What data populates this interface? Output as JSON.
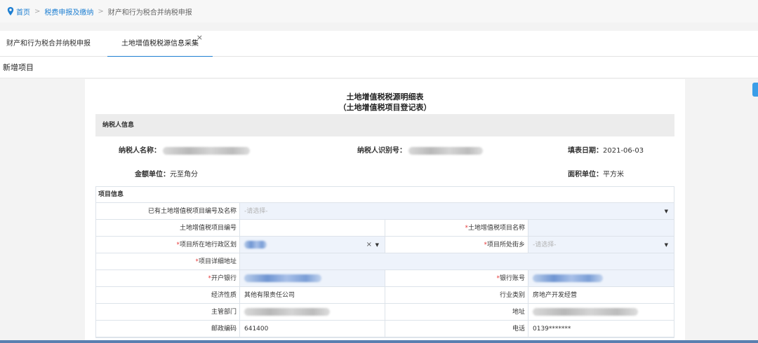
{
  "breadcrumb": {
    "home": "首页",
    "sep": ">",
    "level2": "税费申报及缴纳",
    "current": "财产和行为税合并纳税申报"
  },
  "tabs": [
    {
      "label": "财产和行为税合并纳税申报"
    },
    {
      "label": "土地增值税税源信息采集",
      "close": "×"
    }
  ],
  "subbar": {
    "title": "新增项目"
  },
  "form": {
    "title": "土地增值税税源明细表",
    "subtitle": "（土地增值税项目登记表）",
    "taxpayer_section": "纳税人信息",
    "taxpayer_name_label": "纳税人名称：",
    "taxpayer_id_label": "纳税人识别号：",
    "fill_date_label": "填表日期：",
    "fill_date": "2021-06-03",
    "amount_unit_label": "金额单位：",
    "amount_unit": "元至角分",
    "area_unit_label": "面积单位：",
    "area_unit": "平方米",
    "project_section": "项目信息",
    "rows": {
      "existing_project": {
        "label": "已有土地增值税项目编号及名称",
        "placeholder": "-请选择-"
      },
      "project_no": {
        "label": "土地增值税项目编号"
      },
      "project_name": {
        "label": "土地增值税项目名称"
      },
      "district": {
        "label": "项目所在地行政区划",
        "clear": "×"
      },
      "street": {
        "label": "项目所处街乡",
        "placeholder": "-请选择-"
      },
      "address_detail": {
        "label": "项目详细地址"
      },
      "bank": {
        "label": "开户银行"
      },
      "account": {
        "label": "银行账号"
      },
      "econ_nature": {
        "label": "经济性质",
        "value": "其他有限责任公司"
      },
      "industry": {
        "label": "行业类别",
        "value": "房地产开发经营"
      },
      "authority": {
        "label": "主管部门"
      },
      "address": {
        "label": "地址"
      },
      "postcode": {
        "label": "邮政编码",
        "value": "641400"
      },
      "phone": {
        "label": "电话",
        "value": "0139*******"
      }
    }
  },
  "colors": {
    "accent": "#1e7fd2",
    "required": "#e63b3b",
    "input_bg": "#eef3fb"
  }
}
